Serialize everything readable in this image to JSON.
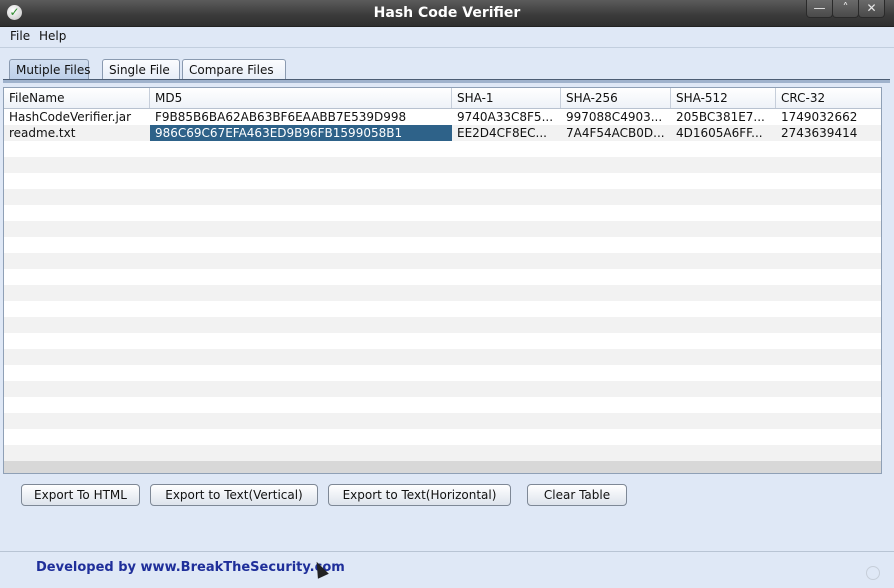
{
  "window": {
    "title": "Hash Code Verifier",
    "icon": "check-icon",
    "controls": [
      "minimize-icon",
      "maximize-icon",
      "close-icon"
    ],
    "control_glyphs": [
      "—",
      "˄",
      "✕"
    ]
  },
  "menu": {
    "items": [
      "File",
      "Help"
    ]
  },
  "tabs": [
    "Mutiple Files",
    "Single File",
    "Compare Files"
  ],
  "table": {
    "columns": [
      "FileName",
      "MD5",
      "SHA-1",
      "SHA-256",
      "SHA-512",
      "CRC-32"
    ],
    "rows": [
      [
        "HashCodeVerifier.jar",
        "F9B85B6BA62AB63BF6EAABB7E539D998",
        "9740A33C8F5...",
        "997088C4903...",
        "205BC381E7...",
        "1749032662"
      ],
      [
        "readme.txt",
        "986C69C67EFA463ED9B96FB1599058B1",
        "EE2D4CF8EC...",
        "7A4F54ACB0D...",
        "4D1605A6FF...",
        "2743639414"
      ]
    ],
    "selected_cell": {
      "row": 1,
      "column": 1
    },
    "selection_color": "#2e6289"
  },
  "buttons": [
    "Export To HTML",
    "Export to Text(Vertical)",
    "Export to Text(Horizontal)",
    "Clear Table"
  ],
  "footer": {
    "text": "Developed by www.BreakTheSecurity.com",
    "color": "#1f2f9a"
  }
}
